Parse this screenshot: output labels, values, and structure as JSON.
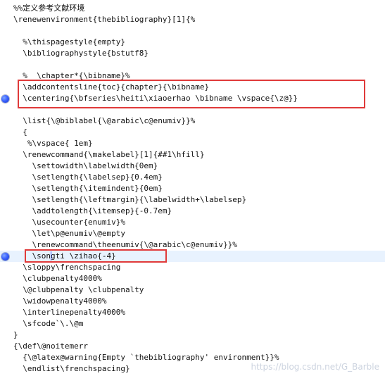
{
  "editor": {
    "lines": [
      "%%定义参考文献环境",
      "\\renewenvironment{thebibliography}[1]{%",
      "",
      "  %\\thispagestyle{empty}",
      "  \\bibliographystyle{bstutf8}",
      "",
      "  %  \\chapter*{\\bibname}%",
      "  \\addcontentsline{toc}{chapter}{\\bibname}",
      "  \\centering{\\bfseries\\heiti\\xiaoerhao \\bibname \\vspace{\\z@}}",
      "",
      "  \\list{\\@biblabel{\\@arabic\\c@enumiv}}%",
      "  {",
      "   %\\vspace{ 1em}",
      "  \\renewcommand{\\makelabel}[1]{##1\\hfill}",
      "    \\settowidth\\labelwidth{0em}",
      "    \\setlength{\\labelsep}{0.4em}",
      "    \\setlength{\\itemindent}{0em}",
      "    \\setlength{\\leftmargin}{\\labelwidth+\\labelsep}",
      "    \\addtolength{\\itemsep}{-0.7em}",
      "    \\usecounter{enumiv}%",
      "    \\let\\p@enumiv\\@empty",
      "    \\renewcommand\\theenumiv{\\@arabic\\c@enumiv}}%",
      "    \\songti \\zihao{-4}",
      "  \\sloppy\\frenchspacing",
      "  \\clubpenalty4000%",
      "  \\@clubpenalty \\clubpenalty",
      "  \\widowpenalty4000%",
      "  \\interlinepenalty4000%",
      "  \\sfcode`\\.\\@m",
      "}",
      "{\\def\\@noitemerr",
      "  {\\@latex@warning{Empty `thebibliography' environment}}%",
      "  \\endlist\\frenchspacing}"
    ],
    "breakpoints": [
      8,
      22
    ],
    "current_line": 22
  },
  "watermark": "https://blog.csdn.net/G_Barble",
  "colors": {
    "background": "#ffffff",
    "text": "#111111",
    "current_line": "#e8f2fe",
    "highlight": "#e03a3a",
    "breakpoint": "#3c63ff"
  }
}
